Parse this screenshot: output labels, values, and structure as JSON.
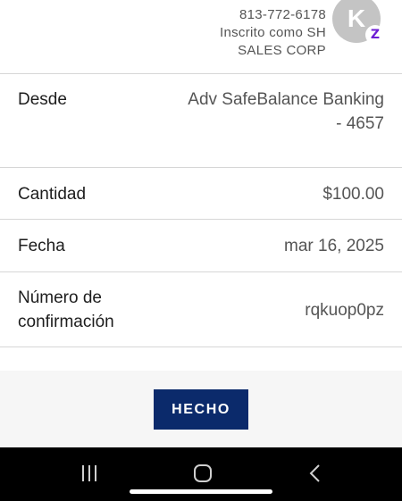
{
  "recipient": {
    "phone": "813-772-6178",
    "enrolled_as": "Inscrito como SH",
    "company": "SALES CORP",
    "avatar_initial": "K",
    "badge_icon": "zelle-logo-icon"
  },
  "details": {
    "from_label": "Desde",
    "from_value_line1": "Adv SafeBalance Banking",
    "from_value_line2": "- 4657",
    "amount_label": "Cantidad",
    "amount_value": "$100.00",
    "date_label": "Fecha",
    "date_value": "mar 16, 2025",
    "confirmation_label_line1": "Número de",
    "confirmation_label_line2": "confirmación",
    "confirmation_value": "rqkuop0pz"
  },
  "actions": {
    "done_label": "HECHO"
  },
  "system_nav": {
    "buttons": [
      "recents-icon",
      "home-icon",
      "back-icon"
    ]
  },
  "colors": {
    "button_bg": "#0b2a6b",
    "avatar_bg": "#c4c4c4",
    "zelle": "#6d1ed4",
    "footer_bg": "#f6f6f6"
  }
}
